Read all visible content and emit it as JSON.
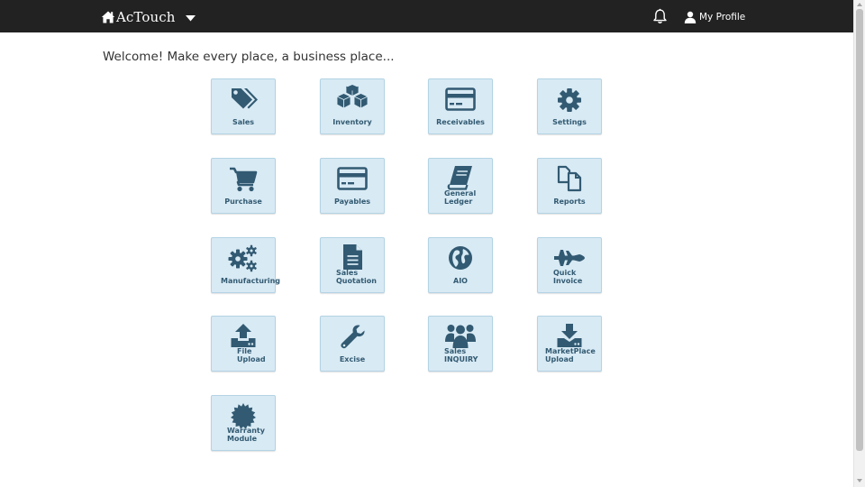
{
  "header": {
    "brand": "AcTouch",
    "home_icon": "home-icon",
    "dropdown_icon": "caret-down-icon",
    "notification_icon": "bell-icon",
    "profile_label": "My Profile",
    "profile_icon": "user-icon",
    "background": "#222222"
  },
  "welcome": "Welcome! Make every place, a business place...",
  "tile_style": {
    "background": "#d8eaf4",
    "border": "#b3d3e4",
    "icon_color": "#325a72"
  },
  "tiles": [
    {
      "label": [
        "Sales"
      ],
      "icon": "tags-icon"
    },
    {
      "label": [
        "Inventory"
      ],
      "icon": "cubes-icon"
    },
    {
      "label": [
        "Receivables"
      ],
      "icon": "credit-card-icon"
    },
    {
      "label": [
        "Settings"
      ],
      "icon": "gear-icon"
    },
    {
      "label": [
        "Purchase"
      ],
      "icon": "shopping-cart-icon"
    },
    {
      "label": [
        "Payables"
      ],
      "icon": "credit-card-icon"
    },
    {
      "label": [
        "General",
        "Ledger"
      ],
      "icon": "book-icon"
    },
    {
      "label": [
        "Reports"
      ],
      "icon": "copy-icon"
    },
    {
      "label": [
        "Manufacturing"
      ],
      "icon": "cogs-icon"
    },
    {
      "label": [
        "Sales",
        "Quotation"
      ],
      "icon": "file-text-icon"
    },
    {
      "label": [
        "AIO"
      ],
      "icon": "globe-icon"
    },
    {
      "label": [
        "Quick",
        "Invoice"
      ],
      "icon": "fighter-jet-icon"
    },
    {
      "label": [
        "File",
        "Upload"
      ],
      "icon": "upload-icon"
    },
    {
      "label": [
        "Excise"
      ],
      "icon": "wrench-icon"
    },
    {
      "label": [
        "Sales",
        "INQUIRY"
      ],
      "icon": "users-icon"
    },
    {
      "label": [
        "MarketPlace",
        "Upload"
      ],
      "icon": "download-icon"
    },
    {
      "label": [
        "Warranty",
        "Module"
      ],
      "icon": "certificate-icon"
    }
  ]
}
